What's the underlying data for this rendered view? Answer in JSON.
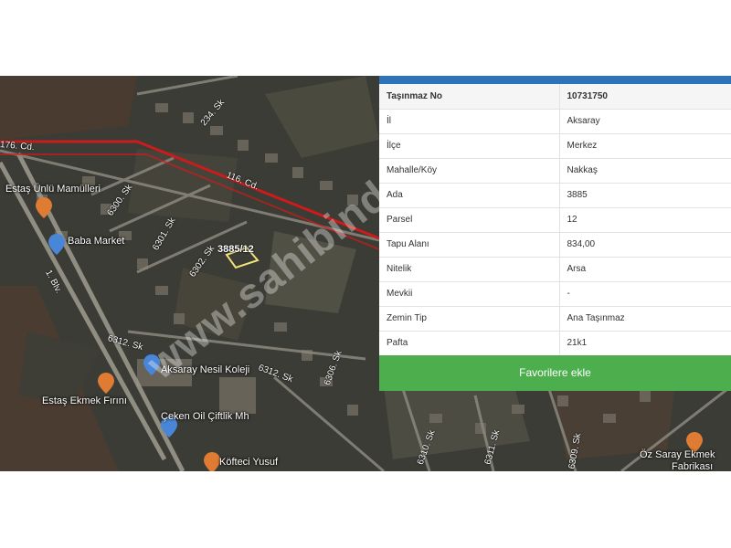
{
  "map": {
    "poi": {
      "estas_unlu": "Estaş Ünlü Mamülleri",
      "baba_market": "Baba Market",
      "aksaray_nesil": "Aksaray Nesil Koleji",
      "estas_ekmek": "Estaş Ekmek Fırını",
      "ceken_oil": "Çeken Oil Çiftlik Mh",
      "kofteci": "Köfteci Yusuf",
      "oz_saray": "Öz Saray Ekmek",
      "fabrikasi": "Fabrikası"
    },
    "streets": {
      "s116": "116. Cd.",
      "s176": "176. Cd.",
      "s6300": "6300. Sk",
      "s6301": "6301. Sk",
      "s6302": "6302. Sk",
      "s6312": "6312. Sk",
      "s6312b": "6312. Sk",
      "s6306": "6306. Sk",
      "s6310": "6310. Sk",
      "s6311": "6311. Sk",
      "s6309": "6309. Sk",
      "s234": "234. Sk",
      "s1blv": "1. Blv."
    },
    "parcel_label": "3885/12",
    "watermark": "www.sahibinden.com"
  },
  "panel": {
    "accent_color": "#2d73b8",
    "rows": [
      {
        "label": "Taşınmaz No",
        "value": "10731750"
      },
      {
        "label": "İl",
        "value": "Aksaray"
      },
      {
        "label": "İlçe",
        "value": "Merkez"
      },
      {
        "label": "Mahalle/Köy",
        "value": "Nakkaş"
      },
      {
        "label": "Ada",
        "value": "3885"
      },
      {
        "label": "Parsel",
        "value": "12"
      },
      {
        "label": "Tapu Alanı",
        "value": "834,00"
      },
      {
        "label": "Nitelik",
        "value": "Arsa"
      },
      {
        "label": "Mevkii",
        "value": "-"
      },
      {
        "label": "Zemin Tip",
        "value": "Ana Taşınmaz"
      },
      {
        "label": "Pafta",
        "value": "21k1"
      }
    ],
    "favorite_button": "Favorilere ekle",
    "button_color": "#4cae4c"
  }
}
